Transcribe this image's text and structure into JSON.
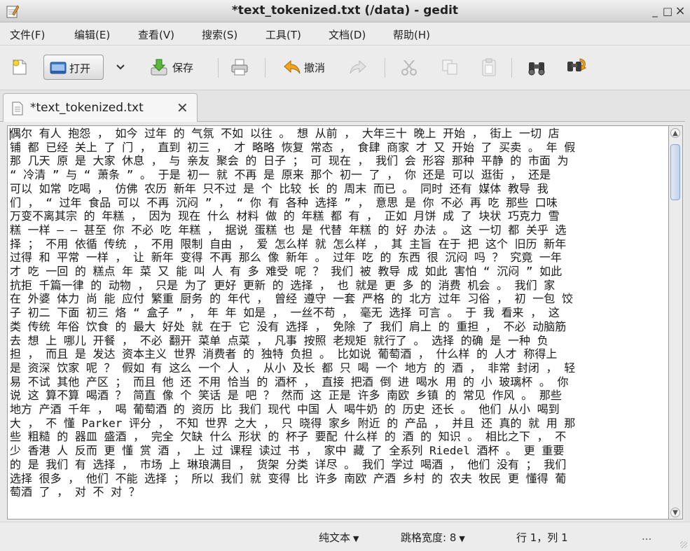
{
  "window": {
    "title": "*text_tokenized.txt (/data) - gedit",
    "minimize_glyph": "_",
    "maximize_glyph": "□",
    "close_glyph": "×",
    "app_icon": "gedit-notepad-icon"
  },
  "menu": [
    "文件(F)",
    "编辑(E)",
    "查看(V)",
    "搜索(S)",
    "工具(T)",
    "文档(D)",
    "帮助(H)"
  ],
  "toolbar": {
    "new_icon": "new-document-icon",
    "open_label": "打开",
    "open_icon": "folder-open-icon",
    "save_label": "保存",
    "save_icon": "save-arrow-icon",
    "print_icon": "printer-icon",
    "undo_label": "撤消",
    "undo_icon": "undo-arrow-icon",
    "redo_icon": "redo-arrow-icon",
    "cut_icon": "scissors-icon",
    "copy_icon": "copy-icon",
    "paste_icon": "paste-icon",
    "find_icon": "binoculars-icon",
    "replace_icon": "find-replace-icon"
  },
  "tab": {
    "label": "*text_tokenized.txt",
    "close_glyph": "✕",
    "icon": "text-document-icon"
  },
  "document": {
    "lines": [
      "偶尔 有人 抱怨 ， 如今 过年 的 气氛 不如 以往 。 想 从前 ， 大年三十 晚上 开始 ， 街上 一切 店",
      "铺 都 已经 关上 了 门 ， 直到 初三 ， 才 略略 恢复 常态 ， 食肆 商家 才 又 开始 了 买卖 。 年 假",
      "那 几天 原 是 大家 休息 ， 与 亲友 聚会 的 日子 ； 可 现在 ， 我们 会 形容 那种 平静 的 市面 为",
      "“ 冷清 ” 与 “ 萧条 ” 。 于是 初一 就 不再 是 原来 那个 初一 了 ， 你 还是 可以 逛街 ， 还是",
      "可以 如常 吃喝 ， 仿佛 农历 新年 只不过 是 个 比较 长 的 周末 而已 。 同时 还有 媒体 教导 我",
      "们 ， “ 过年 食品 可以 不再 沉闷 ” ， “ 你 有 各种 选择 ” ， 意思 是 你 不必 再 吃 那些 口味",
      "万变不离其宗 的 年糕 ， 因为 现在 什么 材料 做 的 年糕 都 有 ， 正如 月饼 成 了 块状 巧克力 雪",
      "糕 一样 — — 甚至 你 不必 吃 年糕 ， 据说 蛋糕 也 是 代替 年糕 的 好 办法 。 这 一切 都 关乎 选",
      "择 ； 不用 依循 传统 ， 不用 限制 自由 ， 爱 怎么样 就 怎么样 ， 其 主旨 在于 把 这个 旧历 新年",
      "过得 和 平常 一样 ， 让 新年 变得 不再 那么 像 新年 。 过年 吃 的 东西 很 沉闷 吗 ？ 究竟 一年",
      "才 吃 一回 的 糕点 年 菜 又 能 叫 人 有 多 难受 呢 ？ 我们 被 教导 成 如此 害怕 “ 沉闷 ” 如此",
      "抗拒 千篇一律 的 动物 ， 只是 为了 更好 更新 的 选择 ， 也 就是 更 多 的 消费 机会 。 我们 家",
      "在 外婆 体力 尚 能 应付 繁重 厨务 的 年代 ， 曾经 遵守 一套 严格 的 北方 过年 习俗 ， 初 一包 饺",
      "子 初二 下面 初三 烙 “ 盒子 ” ， 年 年 如是 ， 一丝不苟 ， 毫无 选择 可言 。 于 我 看来 ， 这",
      "类 传统 年俗 饮食 的 最大 好处 就 在于 它 没有 选择 ， 免除 了 我们 肩上 的 重担 ， 不必 动脑筋",
      "去 想 上 哪儿 开餐 ， 不必 翻开 菜单 点菜 ， 凡事 按照 老规矩 就行了 。 选择 的确 是 一种 负",
      "担 ， 而且 是 发达 资本主义 世界 消费者 的 独特 负担 。 比如说 葡萄酒 ， 什么样 的 人才 称得上",
      "是 资深 饮家 呢 ？ 假如 有 这么 一个 人 ， 从小 及长 都 只 喝 一个 地方 的 酒 ， 非常 封闭 ， 轻",
      "易 不试 其他 产区 ； 而且 他 还 不用 恰当 的 酒杯 ， 直接 把酒 倒 进 喝水 用 的 小 玻璃杯 。 你",
      "说 这 算不算 喝酒 ？ 简直 像 个 笑话 是 吧 ？ 然而 这 正是 许多 南欧 乡镇 的 常见 作风 。 那些",
      "地方 产酒 千年 ， 喝 葡萄酒 的 资历 比 我们 现代 中国 人 喝牛奶 的 历史 还长 。 他们 从小 喝到",
      "大 ， 不 懂 Parker 评分 ， 不知 世界 之大 ， 只 晓得 家乡 附近 的 产品 ， 并且 还 真的 就 用 那",
      "些 粗糙 的 器皿 盛酒 ， 完全 欠缺 什么 形状 的 杯子 要配 什么样 的 酒 的 知识 。 相比之下 ， 不",
      "少 香港 人 反而 更 懂 赏 酒 ， 上 过 课程 读过 书 ， 家中 藏 了 全系列 Riedel 酒杯 。 更 重要",
      "的 是 我们 有 选择 ， 市场 上 琳琅满目 ， 货架 分类 详尽 。 我们 学过 喝酒 ， 他们 没有 ； 我们",
      "选择 很多 ， 他们 不能 选择 ； 所以 我们 就 变得 比 许多 南欧 产酒 乡村 的 农夫 牧民 更 懂得 葡",
      "萄酒 了 ， 对 不 对 ？"
    ]
  },
  "statusbar": {
    "language": "纯文本",
    "tab_width": "跳格宽度: 8",
    "position": "行 1，列 1",
    "ellipsis": "..."
  }
}
